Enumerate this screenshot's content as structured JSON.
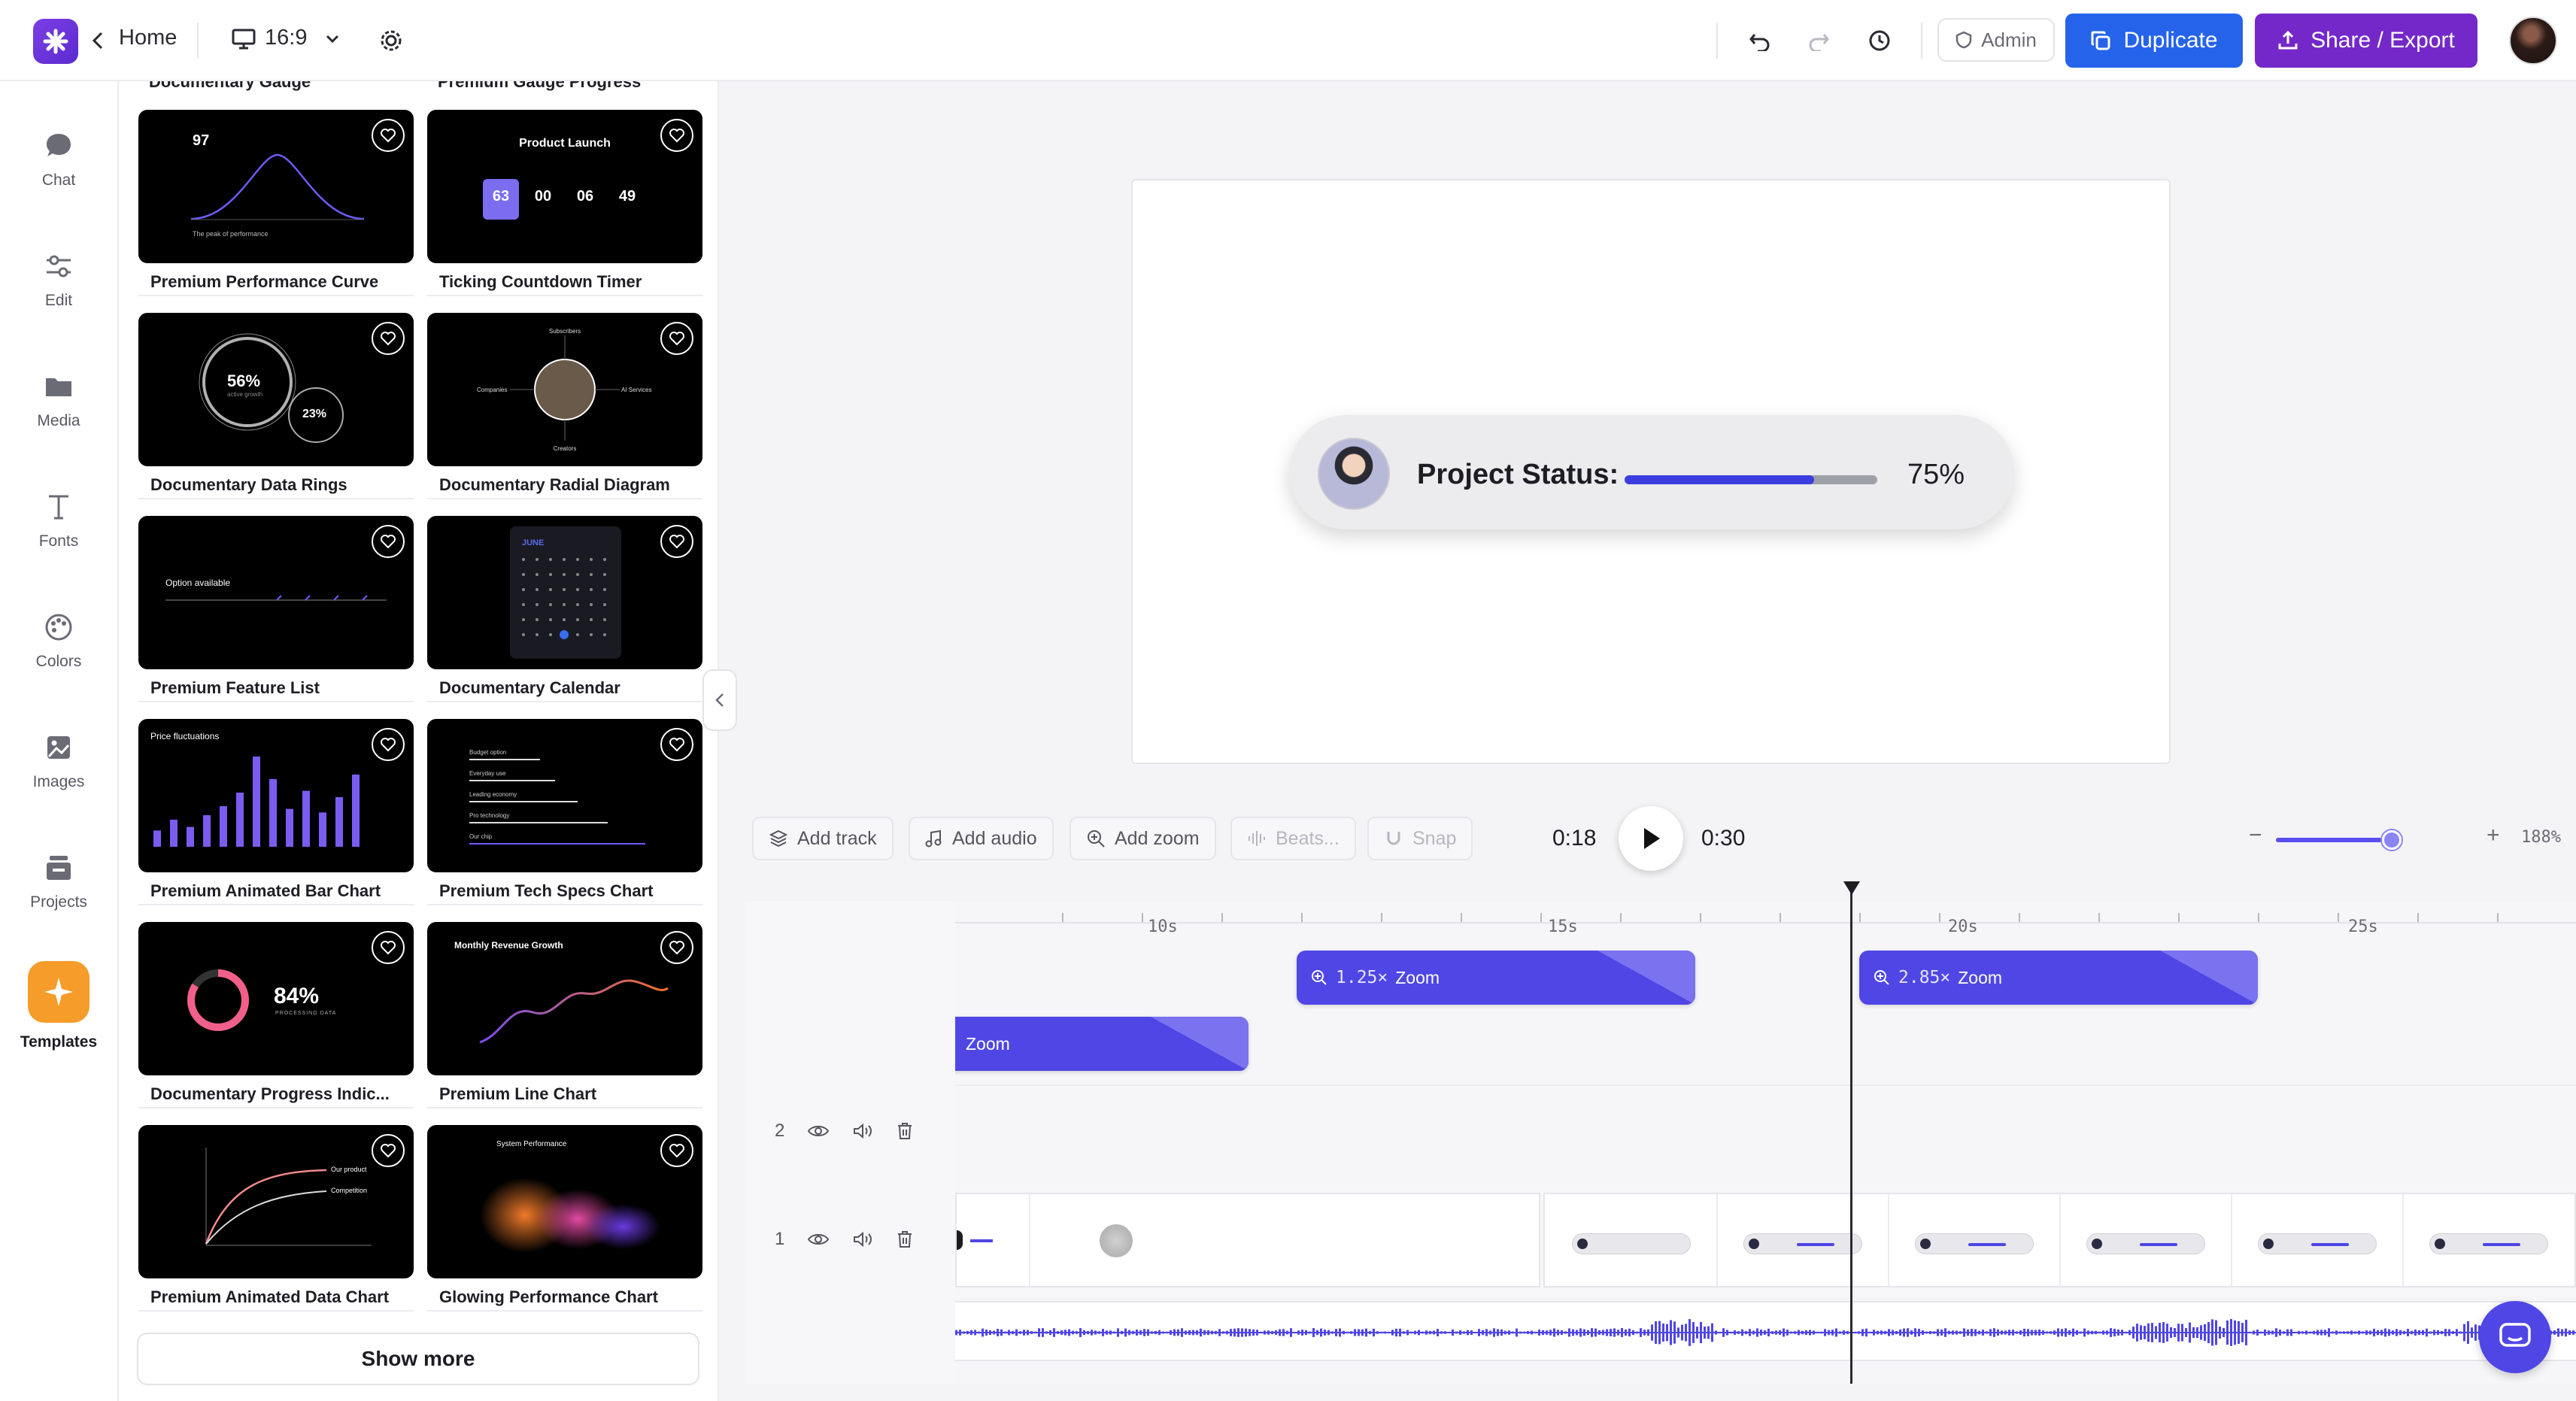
{
  "topbar": {
    "home_label": "Home",
    "aspect_label": "16:9",
    "admin_label": "Admin",
    "duplicate_label": "Duplicate",
    "share_label": "Share / Export"
  },
  "leftnav": {
    "items": [
      {
        "label": "Chat",
        "icon": "chat-icon"
      },
      {
        "label": "Edit",
        "icon": "sliders-icon"
      },
      {
        "label": "Media",
        "icon": "folder-icon"
      },
      {
        "label": "Fonts",
        "icon": "text-icon"
      },
      {
        "label": "Colors",
        "icon": "palette-icon"
      },
      {
        "label": "Images",
        "icon": "image-icon"
      },
      {
        "label": "Projects",
        "icon": "projects-icon"
      },
      {
        "label": "Templates",
        "icon": "sparkle-icon"
      }
    ]
  },
  "panel": {
    "cutoff_left": "Documentary Gauge",
    "cutoff_right": "Premium Gauge Progress",
    "cards": [
      {
        "label": "Premium Performance Curve"
      },
      {
        "label": "Ticking Countdown Timer"
      },
      {
        "label": "Documentary Data Rings"
      },
      {
        "label": "Documentary Radial Diagram"
      },
      {
        "label": "Premium Feature List"
      },
      {
        "label": "Documentary Calendar"
      },
      {
        "label": "Premium Animated Bar Chart"
      },
      {
        "label": "Premium Tech Specs Chart"
      },
      {
        "label": "Documentary Progress Indic..."
      },
      {
        "label": "Premium Line Chart"
      },
      {
        "label": "Premium Animated Data Chart"
      },
      {
        "label": "Glowing Performance Chart"
      }
    ],
    "show_more": "Show more",
    "thumbs": {
      "curve_value": "97",
      "curve_caption": "The peak of performance",
      "countdown_title": "Product Launch",
      "countdown": [
        "63",
        "00",
        "06",
        "49"
      ],
      "rings_main": "56%",
      "rings_small": "23%",
      "rings_caption": "active growth",
      "radial_labels": [
        "Subscribers",
        "Companies",
        "AI Services",
        "Creators"
      ],
      "feature_text": "Option available",
      "calendar_month": "JUNE",
      "bar_title": "Price fluctuations",
      "bar_values": [
        18,
        30,
        22,
        35,
        45,
        60,
        100,
        75,
        42,
        62,
        38,
        55,
        80
      ],
      "tech_rows": [
        "Budget option",
        "Everyday use",
        "Leading economy",
        "Pro technology",
        "Our chip"
      ],
      "progress_pct": "84%",
      "progress_caption": "PROCESSING DATA",
      "progress_value": 0.84,
      "line_title": "Monthly Revenue Growth",
      "data_chart_labels": [
        "Our product",
        "Competition"
      ],
      "glow_title": "System Performance"
    }
  },
  "canvas": {
    "status_label": "Project Status:",
    "status_pct_text": "75%",
    "status_value": 0.75
  },
  "timeline_toolbar": {
    "add_track": "Add track",
    "add_audio": "Add audio",
    "add_zoom": "Add zoom",
    "beats": "Beats...",
    "snap": "Snap",
    "time_current": "0:18",
    "time_total": "0:30",
    "zoom_level": "188%",
    "zoom_slider_value": 0.93
  },
  "timeline": {
    "ruler_labels": [
      "10s",
      "15s",
      "20s",
      "25s"
    ],
    "zoom_blocks": [
      {
        "mult": "1.25×",
        "label": "Zoom"
      },
      {
        "mult": "2.85×",
        "label": "Zoom"
      },
      {
        "mult": "",
        "label": "Zoom"
      }
    ],
    "tracks": [
      {
        "number": "2"
      },
      {
        "number": "1"
      }
    ]
  },
  "colors": {
    "accent_blue": "#2563eb",
    "accent_purple": "#7428c9",
    "zoom_block": "#4f46e5",
    "template_orange": "#f59c2a"
  }
}
